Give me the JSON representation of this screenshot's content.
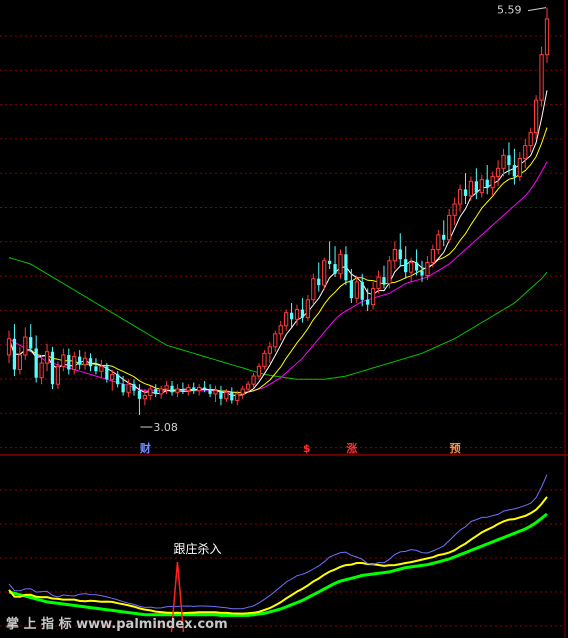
{
  "colors": {
    "background": "#000000",
    "up": "#ff3b3b",
    "down": "#54ffff",
    "grid": "#8c0000",
    "ma5": "#ffffff",
    "ma10": "#ffff00",
    "ma20": "#ff00ff",
    "ma60": "#00c800",
    "ind_a": "#7070ff",
    "ind_b": "#ffff00",
    "ind_c": "#00ff00",
    "signal": "#ff2020"
  },
  "chart_data": {
    "type": "candlestick",
    "max_label": "5.59",
    "min_label": "3.08",
    "markers": [
      {
        "text": "财",
        "index": 25,
        "color": "#7090ff"
      },
      {
        "text": "$",
        "index": 55,
        "color": "#ff3030"
      },
      {
        "text": "涨",
        "index": 63,
        "color": "#ff3030"
      },
      {
        "text": "预",
        "index": 82,
        "color": "#ff8c40"
      }
    ],
    "signal": {
      "text": "跟庄杀入",
      "index": 31
    },
    "watermark": "掌 上 指 标  www.palmindex.com",
    "ohlc": [
      [
        3.45,
        3.6,
        3.4,
        3.55
      ],
      [
        3.55,
        3.64,
        3.32,
        3.36
      ],
      [
        3.36,
        3.5,
        3.33,
        3.45
      ],
      [
        3.45,
        3.62,
        3.42,
        3.56
      ],
      [
        3.56,
        3.64,
        3.47,
        3.49
      ],
      [
        3.49,
        3.57,
        3.28,
        3.31
      ],
      [
        3.31,
        3.45,
        3.27,
        3.4
      ],
      [
        3.4,
        3.52,
        3.35,
        3.47
      ],
      [
        3.47,
        3.5,
        3.24,
        3.27
      ],
      [
        3.27,
        3.41,
        3.24,
        3.38
      ],
      [
        3.38,
        3.49,
        3.35,
        3.45
      ],
      [
        3.45,
        3.49,
        3.33,
        3.36
      ],
      [
        3.36,
        3.47,
        3.33,
        3.44
      ],
      [
        3.44,
        3.48,
        3.36,
        3.39
      ],
      [
        3.39,
        3.47,
        3.36,
        3.43
      ],
      [
        3.43,
        3.46,
        3.35,
        3.38
      ],
      [
        3.38,
        3.43,
        3.33,
        3.35
      ],
      [
        3.35,
        3.42,
        3.31,
        3.38
      ],
      [
        3.38,
        3.4,
        3.28,
        3.3
      ],
      [
        3.3,
        3.36,
        3.23,
        3.33
      ],
      [
        3.33,
        3.35,
        3.25,
        3.27
      ],
      [
        3.27,
        3.32,
        3.2,
        3.22
      ],
      [
        3.22,
        3.3,
        3.19,
        3.27
      ],
      [
        3.27,
        3.3,
        3.2,
        3.23
      ],
      [
        3.23,
        3.27,
        3.08,
        3.18
      ],
      [
        3.18,
        3.24,
        3.14,
        3.2
      ],
      [
        3.2,
        3.26,
        3.17,
        3.24
      ],
      [
        3.24,
        3.27,
        3.19,
        3.21
      ],
      [
        3.21,
        3.26,
        3.18,
        3.24
      ],
      [
        3.24,
        3.29,
        3.21,
        3.26
      ],
      [
        3.26,
        3.29,
        3.2,
        3.22
      ],
      [
        3.22,
        3.27,
        3.19,
        3.24
      ],
      [
        3.24,
        3.28,
        3.21,
        3.23
      ],
      [
        3.23,
        3.27,
        3.2,
        3.25
      ],
      [
        3.25,
        3.28,
        3.21,
        3.23
      ],
      [
        3.23,
        3.27,
        3.2,
        3.25
      ],
      [
        3.25,
        3.29,
        3.22,
        3.24
      ],
      [
        3.24,
        3.27,
        3.19,
        3.21
      ],
      [
        3.21,
        3.26,
        3.16,
        3.23
      ],
      [
        3.23,
        3.26,
        3.14,
        3.18
      ],
      [
        3.18,
        3.24,
        3.16,
        3.22
      ],
      [
        3.22,
        3.25,
        3.15,
        3.17
      ],
      [
        3.17,
        3.23,
        3.14,
        3.21
      ],
      [
        3.21,
        3.26,
        3.18,
        3.24
      ],
      [
        3.24,
        3.29,
        3.22,
        3.27
      ],
      [
        3.27,
        3.34,
        3.25,
        3.32
      ],
      [
        3.32,
        3.4,
        3.3,
        3.38
      ],
      [
        3.38,
        3.48,
        3.36,
        3.46
      ],
      [
        3.46,
        3.53,
        3.4,
        3.5
      ],
      [
        3.5,
        3.6,
        3.47,
        3.58
      ],
      [
        3.58,
        3.66,
        3.54,
        3.63
      ],
      [
        3.63,
        3.73,
        3.6,
        3.71
      ],
      [
        3.71,
        3.77,
        3.62,
        3.67
      ],
      [
        3.67,
        3.76,
        3.63,
        3.73
      ],
      [
        3.73,
        3.8,
        3.65,
        3.68
      ],
      [
        3.68,
        3.82,
        3.66,
        3.79
      ],
      [
        3.79,
        3.95,
        3.76,
        3.92
      ],
      [
        3.92,
        4.02,
        3.84,
        3.88
      ],
      [
        3.88,
        4.05,
        3.85,
        4.03
      ],
      [
        4.03,
        4.15,
        3.98,
        4.01
      ],
      [
        4.01,
        4.12,
        3.93,
        3.95
      ],
      [
        3.95,
        4.1,
        3.92,
        4.07
      ],
      [
        4.07,
        4.12,
        3.88,
        3.91
      ],
      [
        3.91,
        3.98,
        3.77,
        3.8
      ],
      [
        3.8,
        3.94,
        3.77,
        3.9
      ],
      [
        3.9,
        3.95,
        3.75,
        3.79
      ],
      [
        3.79,
        3.86,
        3.72,
        3.76
      ],
      [
        3.76,
        3.9,
        3.73,
        3.86
      ],
      [
        3.86,
        3.97,
        3.83,
        3.93
      ],
      [
        3.93,
        4.0,
        3.86,
        3.89
      ],
      [
        3.89,
        4.06,
        3.86,
        4.03
      ],
      [
        4.03,
        4.15,
        3.98,
        4.1
      ],
      [
        4.1,
        4.2,
        4.0,
        4.04
      ],
      [
        4.04,
        4.12,
        3.92,
        3.96
      ],
      [
        3.96,
        4.05,
        3.9,
        4.02
      ],
      [
        4.02,
        4.1,
        3.94,
        3.97
      ],
      [
        3.97,
        4.03,
        3.9,
        3.94
      ],
      [
        3.94,
        4.06,
        3.91,
        4.02
      ],
      [
        4.02,
        4.13,
        3.99,
        4.1
      ],
      [
        4.1,
        4.22,
        4.07,
        4.19
      ],
      [
        4.19,
        4.28,
        4.12,
        4.16
      ],
      [
        4.16,
        4.35,
        4.14,
        4.31
      ],
      [
        4.31,
        4.42,
        4.25,
        4.38
      ],
      [
        4.38,
        4.5,
        4.33,
        4.47
      ],
      [
        4.47,
        4.57,
        4.38,
        4.43
      ],
      [
        4.43,
        4.55,
        4.4,
        4.52
      ],
      [
        4.52,
        4.6,
        4.41,
        4.45
      ],
      [
        4.45,
        4.56,
        4.42,
        4.53
      ],
      [
        4.53,
        4.62,
        4.44,
        4.48
      ],
      [
        4.48,
        4.58,
        4.43,
        4.55
      ],
      [
        4.55,
        4.65,
        4.49,
        4.6
      ],
      [
        4.6,
        4.72,
        4.55,
        4.68
      ],
      [
        4.68,
        4.76,
        4.56,
        4.62
      ],
      [
        4.62,
        4.72,
        4.5,
        4.55
      ],
      [
        4.55,
        4.7,
        4.52,
        4.66
      ],
      [
        4.66,
        4.78,
        4.6,
        4.74
      ],
      [
        4.74,
        4.85,
        4.7,
        4.82
      ],
      [
        4.82,
        5.05,
        4.78,
        5.02
      ],
      [
        5.02,
        5.35,
        4.98,
        5.3
      ],
      [
        5.3,
        5.59,
        5.25,
        5.52
      ]
    ],
    "ma20_vals": [
      3.55,
      3.53,
      3.51,
      3.49,
      3.47,
      3.45,
      3.43,
      3.41,
      3.4,
      3.39,
      3.38,
      3.37,
      3.36,
      3.35,
      3.34,
      3.33,
      3.32,
      3.31,
      3.3,
      3.29,
      3.28,
      3.27,
      3.26,
      3.25,
      3.24,
      3.23,
      3.23,
      3.23,
      3.23,
      3.23,
      3.23,
      3.23,
      3.23,
      3.23,
      3.23,
      3.23,
      3.23,
      3.23,
      3.23,
      3.22,
      3.22,
      3.22,
      3.22,
      3.22,
      3.22,
      3.23,
      3.24,
      3.25,
      3.27,
      3.29,
      3.31,
      3.34,
      3.37,
      3.4,
      3.43,
      3.47,
      3.51,
      3.55,
      3.59,
      3.63,
      3.67,
      3.7,
      3.72,
      3.74,
      3.76,
      3.78,
      3.79,
      3.8,
      3.81,
      3.82,
      3.83,
      3.85,
      3.87,
      3.89,
      3.9,
      3.91,
      3.92,
      3.93,
      3.95,
      3.97,
      3.99,
      4.01,
      4.04,
      4.07,
      4.1,
      4.13,
      4.16,
      4.19,
      4.22,
      4.25,
      4.28,
      4.31,
      4.34,
      4.37,
      4.4,
      4.43,
      4.47,
      4.52,
      4.58,
      4.64
    ],
    "ma60_vals": [
      4.05,
      4.04,
      4.03,
      4.02,
      4.01,
      3.99,
      3.97,
      3.95,
      3.93,
      3.91,
      3.89,
      3.87,
      3.85,
      3.83,
      3.81,
      3.79,
      3.77,
      3.75,
      3.73,
      3.71,
      3.69,
      3.67,
      3.65,
      3.63,
      3.61,
      3.59,
      3.57,
      3.55,
      3.53,
      3.51,
      3.5,
      3.49,
      3.48,
      3.47,
      3.46,
      3.45,
      3.44,
      3.43,
      3.42,
      3.41,
      3.4,
      3.39,
      3.38,
      3.37,
      3.36,
      3.35,
      3.34,
      3.33,
      3.325,
      3.32,
      3.315,
      3.31,
      3.305,
      3.3,
      3.3,
      3.3,
      3.3,
      3.3,
      3.3,
      3.305,
      3.31,
      3.315,
      3.32,
      3.33,
      3.34,
      3.35,
      3.36,
      3.37,
      3.38,
      3.39,
      3.4,
      3.41,
      3.42,
      3.43,
      3.44,
      3.45,
      3.46,
      3.475,
      3.49,
      3.505,
      3.52,
      3.535,
      3.55,
      3.57,
      3.59,
      3.61,
      3.63,
      3.65,
      3.67,
      3.69,
      3.71,
      3.73,
      3.75,
      3.77,
      3.8,
      3.83,
      3.86,
      3.89,
      3.92,
      3.96
    ]
  }
}
